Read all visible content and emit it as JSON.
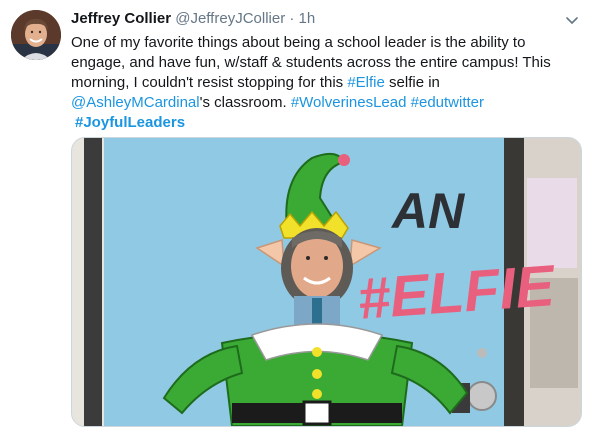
{
  "tweet": {
    "author_name": "Jeffrey Collier",
    "author_handle": "@JeffreyJCollier",
    "separator": "·",
    "timestamp": "1h",
    "text_line1": "One of my favorite things about being a school leader is the ability to",
    "text_line2": "engage, and have fun, w/staff & students across the entire campus!  This",
    "text_line3_prefix": "morning, I couldn't resist stopping for this ",
    "hashtag_elfie": "#Elfie",
    "text_line3_suffix": " selfie in",
    "mention": "@AshleyMCardinal",
    "text_line4_mid": "'s classroom. ",
    "hashtag_wolverines": "#WolverinesLead",
    "hashtag_edutwitter": "#edutwitter",
    "hashtag_joyful": "#JoyfulLeaders"
  },
  "photo": {
    "poster_word_an": "AN",
    "poster_word_elfie": "#ELFIE"
  },
  "icons": {
    "avatar": "author-avatar",
    "menu": "chevron-down-icon"
  },
  "colors": {
    "link": "#1b95e0",
    "text": "#14171a",
    "muted": "#657786",
    "poster_blue": "#8fc9e3",
    "elf_green": "#3aaa35"
  }
}
